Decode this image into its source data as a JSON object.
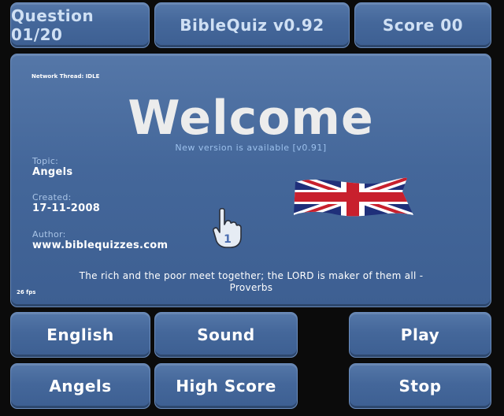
{
  "header": {
    "question": "Question 01/20",
    "app_title": "BibleQuiz v0.92",
    "score": "Score 00"
  },
  "main": {
    "network_status": "Network Thread: IDLE",
    "title": "Welcome",
    "update_notice": "New version is available [v0.91]",
    "topic_label": "Topic:",
    "topic_value": "Angels",
    "created_label": "Created:",
    "created_value": "17-11-2008",
    "author_label": "Author:",
    "author_value": "www.biblequizzes.com",
    "quote_line1": "The rich and the poor meet together; the LORD is maker of them all -",
    "quote_line2": "Proverbs",
    "fps": "26 fps",
    "flag_icon": "uk-flag-icon",
    "cursor_icon": "hand-pointer-icon",
    "cursor_number": "1"
  },
  "buttons": {
    "language": "English",
    "sound": "Sound",
    "play": "Play",
    "topic": "Angels",
    "high_score": "High Score",
    "stop": "Stop"
  },
  "colors": {
    "panel": "#44679a",
    "panel_border": "#6b8cbc",
    "background": "#0b0b0b",
    "header_text": "#cfe0f4",
    "notice_text": "#9cc0ec"
  }
}
